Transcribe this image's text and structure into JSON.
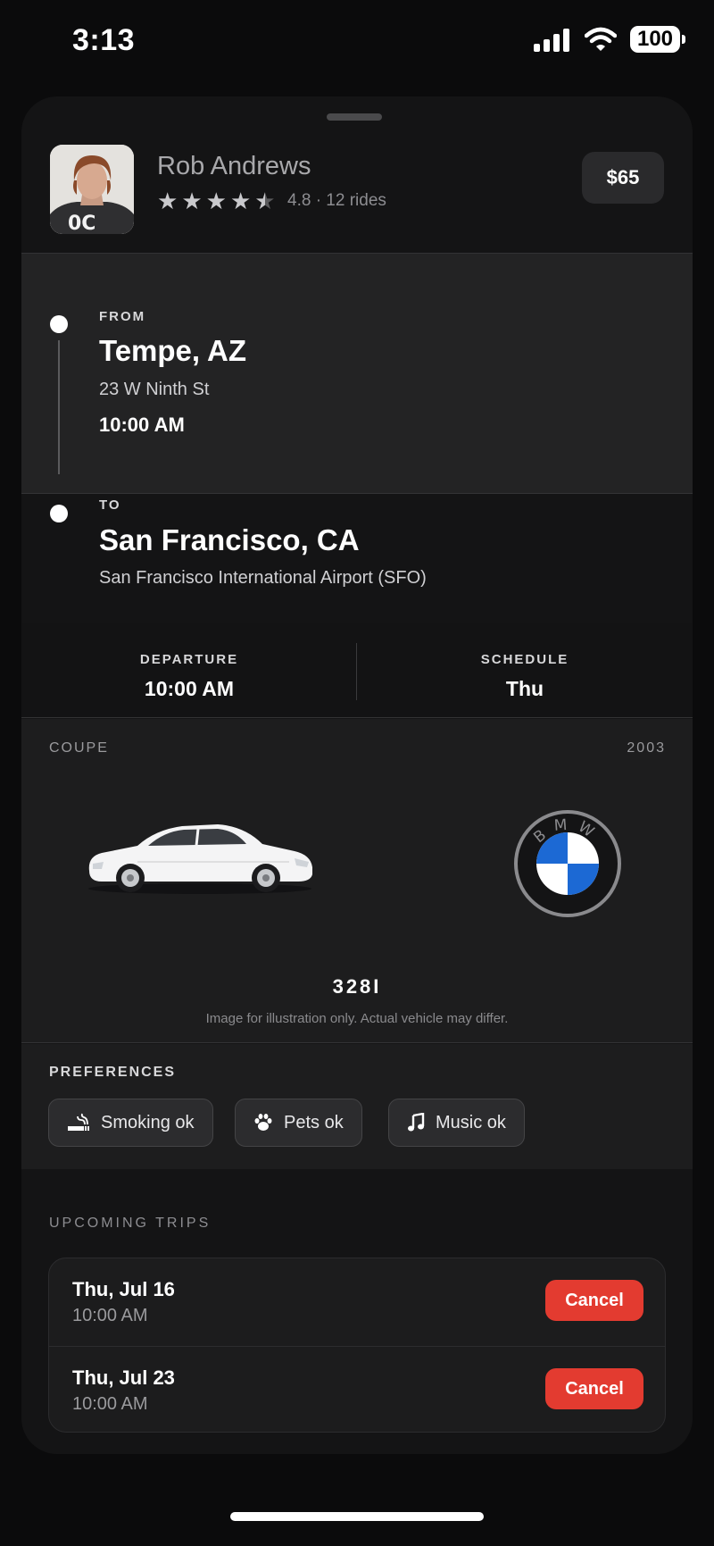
{
  "status_bar": {
    "time": "3:13",
    "battery": "100"
  },
  "driver": {
    "name": "Rob Andrews",
    "rating_value": 4.5,
    "rating_text": "4.8 · 12 rides",
    "price": "$65"
  },
  "route": {
    "from": {
      "label": "FROM",
      "city": "Tempe, AZ",
      "address": "23 W Ninth St",
      "time": "10:00 AM"
    },
    "to": {
      "label": "TO",
      "city": "San Francisco, CA",
      "address": "San Francisco International Airport (SFO)"
    }
  },
  "schedule": {
    "departure_label": "DEPARTURE",
    "departure_value": "10:00 AM",
    "schedule_label": "SCHEDULE",
    "schedule_value": "Thu"
  },
  "vehicle": {
    "type": "COUPE",
    "year": "2003",
    "brand_letters": "BMW",
    "model": "328I",
    "disclaimer": "Image for illustration only. Actual vehicle may differ."
  },
  "preferences": {
    "title": "PREFERENCES",
    "items": [
      {
        "icon": "smoking-icon",
        "label": "Smoking ok"
      },
      {
        "icon": "paw-icon",
        "label": "Pets ok"
      },
      {
        "icon": "music-note-icon",
        "label": "Music ok"
      }
    ]
  },
  "upcoming": {
    "title": "UPCOMING TRIPS",
    "trips": [
      {
        "date": "Thu, Jul 16",
        "time": "10:00 AM",
        "action": "Cancel"
      },
      {
        "date": "Thu, Jul 23",
        "time": "10:00 AM",
        "action": "Cancel"
      }
    ]
  },
  "colors": {
    "cancel": "#e33b30",
    "bmw_blue": "#1c69d4"
  }
}
